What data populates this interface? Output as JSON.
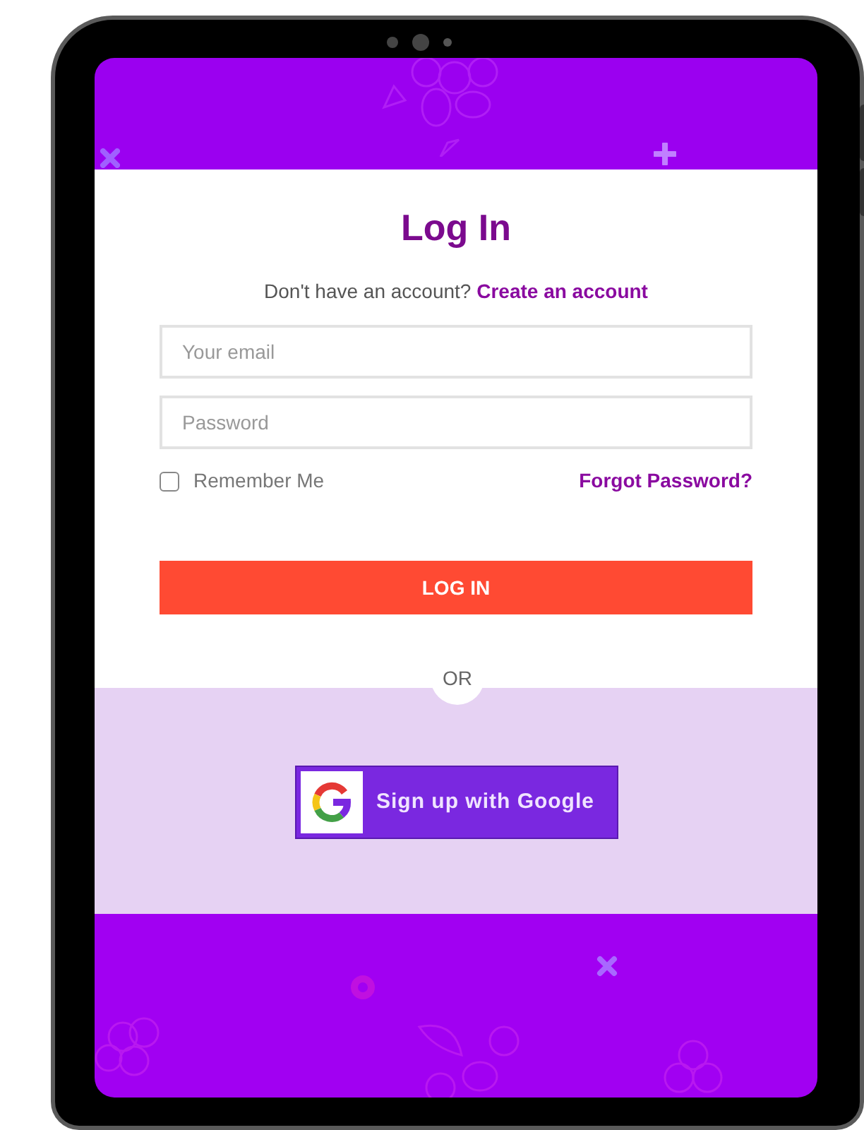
{
  "title": "Log In",
  "signup_prompt": {
    "text": "Don't have an account?",
    "link": "Create an account"
  },
  "fields": [
    {
      "placeholder": "Your email"
    },
    {
      "placeholder": "Password"
    }
  ],
  "remember_me": {
    "label": "Remember Me",
    "checked": false
  },
  "forgot_password": "Forgot Password?",
  "login_button": "LOG IN",
  "divider": "OR",
  "google_button": "Sign up with Google"
}
